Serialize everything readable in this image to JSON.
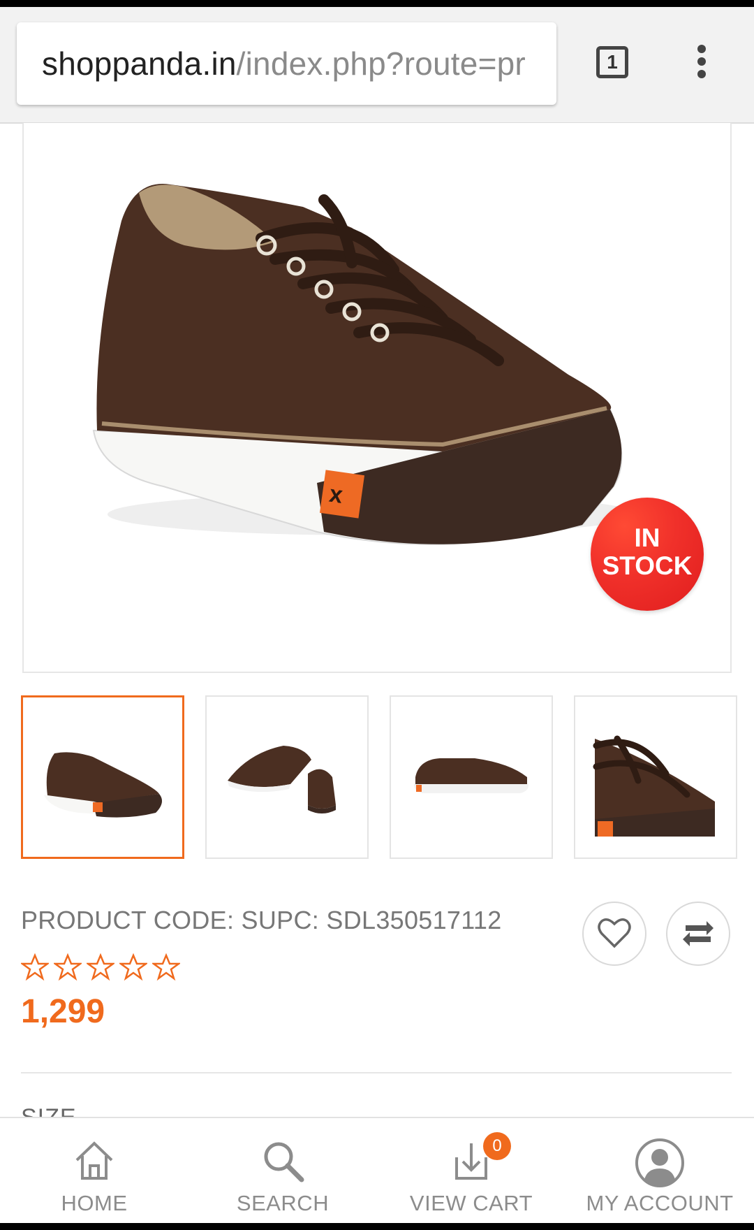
{
  "browser": {
    "url_domain": "shoppanda.in",
    "url_path": "/index.php?route=pr",
    "tab_count": "1"
  },
  "product": {
    "badge_line1": "IN",
    "badge_line2": "STOCK",
    "code_text": "PRODUCT CODE: SUPC: SDL350517112",
    "rating": 0,
    "rating_max": 5,
    "price": "1,299",
    "size_label": "SIZE"
  },
  "bottom_nav": {
    "home": "HOME",
    "search": "SEARCH",
    "view_cart": "VIEW CART",
    "cart_count": "0",
    "my_account": "MY ACCOUNT"
  },
  "icons": [
    "heart-icon",
    "compare-icon",
    "home-icon",
    "search-icon",
    "cart-download-icon",
    "account-icon",
    "star-icon",
    "menu-dots-icon"
  ],
  "colors": {
    "accent": "#f06a1d",
    "badge": "#e8241f",
    "shoe_upper": "#4a2e20",
    "shoe_sole": "#ffffff"
  }
}
